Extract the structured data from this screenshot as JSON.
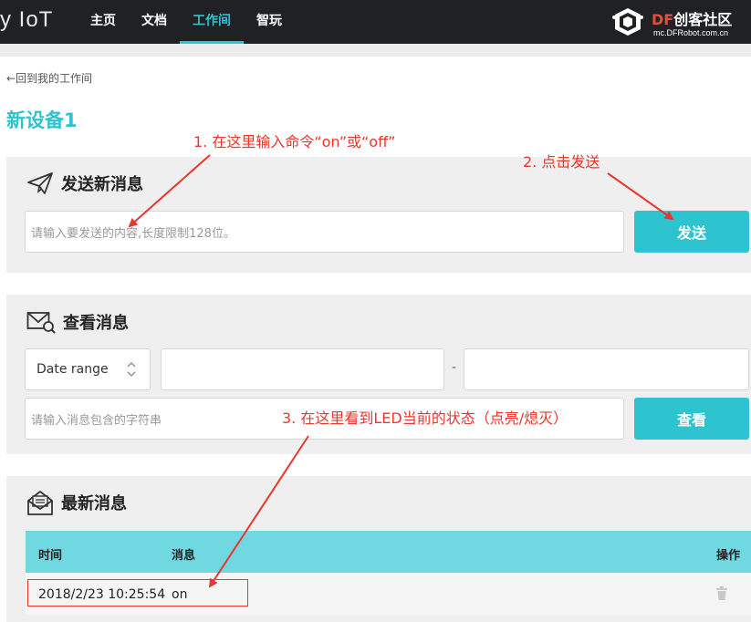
{
  "nav": {
    "brand": "y IoT",
    "items": [
      {
        "label": "主页",
        "active": false
      },
      {
        "label": "文档",
        "active": false
      },
      {
        "label": "工作间",
        "active": true
      },
      {
        "label": "智玩",
        "active": false
      }
    ],
    "logo": {
      "title_prefix": "DF",
      "title": "创客社区",
      "subtitle": "mc.DFRobot.com.cn"
    }
  },
  "back_link": "←回到我的工作间",
  "page_title": "新设备1",
  "send_panel": {
    "title": "发送新消息",
    "input_placeholder": "请输入要发送的内容,长度限制128位。",
    "button": "发送"
  },
  "view_panel": {
    "title": "查看消息",
    "date_range_label": "Date range",
    "separator": "-",
    "filter_placeholder": "请输入消息包含的字符串",
    "button": "查看"
  },
  "latest_panel": {
    "title": "最新消息",
    "columns": [
      "时间",
      "消息",
      "操作"
    ],
    "rows": [
      {
        "time": "2018/2/23 10:25:54",
        "message": "on"
      }
    ]
  },
  "annotations": {
    "step1": "1. 在这里输入命令“on”或“off”",
    "step2": "2. 点击发送",
    "step3": "3. 在这里看到LED当前的状态（点亮/熄灭）"
  },
  "colors": {
    "accent": "#2ec4cf",
    "nav_bg": "#1f2124",
    "panel_bg": "#efefef",
    "table_header": "#6fd8e0",
    "annotation": "#e8372d"
  },
  "icons": {
    "send_panel": "paper-plane-icon",
    "view_panel": "envelope-search-icon",
    "latest_panel": "envelope-open-icon",
    "row_action": "trash-icon",
    "logo": "cube-icon"
  }
}
